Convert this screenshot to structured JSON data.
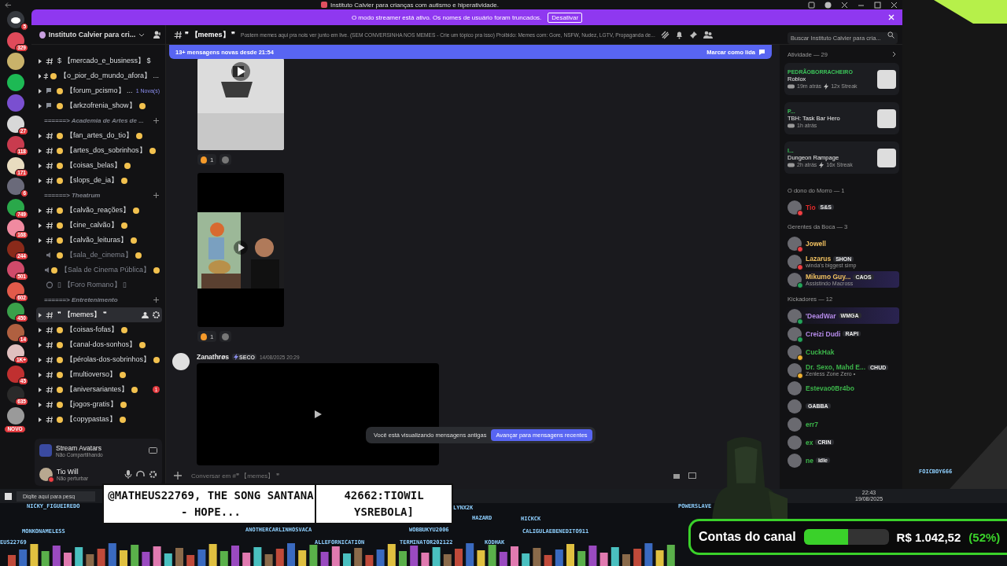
{
  "title_bar": {
    "title": "Instituto Calvier para crianças com autismo e hiperatividade."
  },
  "streamer_banner": {
    "text": "O modo streamer está ativo. Os nomes de usuário foram truncados.",
    "button": "Desativar"
  },
  "servers": [
    {
      "kind": "home",
      "badge": "5",
      "color": "#36393f"
    },
    {
      "kind": "server",
      "badge": "329",
      "color": "#e04a5a"
    },
    {
      "kind": "server",
      "color": "#c9b26a"
    },
    {
      "kind": "server",
      "color": "#1db954"
    },
    {
      "kind": "server",
      "color": "#7a4fd0"
    },
    {
      "kind": "server",
      "badge": "27",
      "color": "#d8d8d8"
    },
    {
      "kind": "server",
      "badge": "118",
      "color": "#c93b4e"
    },
    {
      "kind": "server",
      "badge": "171",
      "color": "#e8dcc0"
    },
    {
      "kind": "server",
      "badge": "6",
      "color": "#6a6a7a"
    },
    {
      "kind": "server",
      "badge": "749",
      "color": "#2aa84a"
    },
    {
      "kind": "server",
      "badge": "168",
      "color": "#f08aa0"
    },
    {
      "kind": "server",
      "badge": "244",
      "color": "#8a2a1a"
    },
    {
      "kind": "server",
      "badge": "501",
      "color": "#d04a6a"
    },
    {
      "kind": "server",
      "badge": "602",
      "color": "#e25a4a"
    },
    {
      "kind": "server",
      "badge": "450",
      "color": "#3aa04a"
    },
    {
      "kind": "server",
      "badge": "14",
      "color": "#b06040"
    },
    {
      "kind": "server",
      "badge": "1K+",
      "color": "#e0c0c0"
    },
    {
      "kind": "server",
      "badge": "45",
      "color": "#c03030"
    },
    {
      "kind": "server",
      "badge": "635",
      "color": "#2a2a2a"
    },
    {
      "kind": "server",
      "badge": "NOVO",
      "color": "#9a9a9a"
    }
  ],
  "server_header": {
    "name": "Instituto Calvier para cri..."
  },
  "channels": [
    {
      "kind": "text",
      "name": "$ 【mercado_e_business】 $",
      "selected": false
    },
    {
      "kind": "text",
      "name": "【o_pior_do_mundo_afora】 ...",
      "leading_emoji": true,
      "trailing_emoji": false,
      "selected": false
    },
    {
      "kind": "forum",
      "name": "【forum_pcismo】 ...",
      "leading_emoji": true,
      "trailing_emoji": false,
      "badge": "1 Nova(s)",
      "selected": false
    },
    {
      "kind": "forum",
      "name": "【arkzofrenia_show】",
      "leading_emoji": true,
      "trailing_emoji": true,
      "selected": false
    },
    {
      "kind": "category",
      "name": "======> Academia de Artes de ..."
    },
    {
      "kind": "text",
      "name": "【fan_artes_do_tio】",
      "leading_emoji": true,
      "trailing_emoji": true,
      "selected": false
    },
    {
      "kind": "text",
      "name": "【artes_dos_sobrinhos】",
      "leading_emoji": true,
      "trailing_emoji": true,
      "selected": false
    },
    {
      "kind": "text",
      "name": "【coisas_belas】",
      "leading_emoji": true,
      "trailing_emoji": true,
      "selected": false
    },
    {
      "kind": "text",
      "name": "【slops_de_ia】",
      "leading_emoji": true,
      "trailing_emoji": true,
      "selected": false
    },
    {
      "kind": "category",
      "name": "======> Theatrum"
    },
    {
      "kind": "text",
      "name": "【calvão_reações】",
      "leading_emoji": true,
      "trailing_emoji": true,
      "selected": false
    },
    {
      "kind": "text",
      "name": "【cine_calvão】",
      "leading_emoji": true,
      "trailing_emoji": true,
      "selected": false
    },
    {
      "kind": "text",
      "name": "【calvão_leituras】",
      "leading_emoji": true,
      "trailing_emoji": true,
      "selected": false
    },
    {
      "kind": "voice",
      "name": "【sala_de_cinema】",
      "leading_emoji": true,
      "trailing_emoji": true,
      "selected": false
    },
    {
      "kind": "voice",
      "name": "【Sala de Cinema Pública】",
      "leading_emoji": true,
      "trailing_emoji": true,
      "selected": false
    },
    {
      "kind": "stage",
      "name": "▯ 【Foro Romano】 ▯",
      "selected": false
    },
    {
      "kind": "category",
      "name": "======> Entretenimento"
    },
    {
      "kind": "text",
      "name": "❞ 【memes】 ❞",
      "selected": true
    },
    {
      "kind": "text",
      "name": "【coisas-fofas】",
      "leading_emoji": true,
      "trailing_emoji": true,
      "selected": false
    },
    {
      "kind": "text",
      "name": "【canal-dos-sonhos】",
      "leading_emoji": true,
      "trailing_emoji": true,
      "selected": false
    },
    {
      "kind": "text",
      "name": "【pérolas-dos-sobrinhos】",
      "leading_emoji": true,
      "trailing_emoji": true,
      "selected": false
    },
    {
      "kind": "text",
      "name": "【multioverso】",
      "leading_emoji": true,
      "trailing_emoji": true,
      "selected": false
    },
    {
      "kind": "text",
      "name": "【aniversariantes】",
      "leading_emoji": true,
      "trailing_emoji": true,
      "mentions": "1",
      "selected": false
    },
    {
      "kind": "text",
      "name": "【jogos-gratis】",
      "leading_emoji": true,
      "trailing_emoji": true,
      "selected": false
    },
    {
      "kind": "text",
      "name": "【copypastas】",
      "leading_emoji": true,
      "trailing_emoji": true,
      "selected": false
    }
  ],
  "app_panel": {
    "name": "Stream Avatars",
    "status": "Não Compartilhando"
  },
  "user_panel": {
    "name": "Tio Will",
    "status": "Não perturbar"
  },
  "chat_header": {
    "channel": "❞ 【memes】 ❞",
    "topic": "Postem memes aqui pra nois ver junto em live. (SEM CONVERSINHA NOS MEMES - Crie um tópico pra isso) Proibido: Memes com: Gore, NSFW, Nudez, LGTV, Propaganda de...",
    "search_placeholder": "Buscar Instituto Calvier para cria..."
  },
  "new_messages_bar": {
    "text": "13+ mensagens novas desde 21:54",
    "action": "Marcar como lida"
  },
  "messages": [
    {
      "kind": "attachment",
      "reaction_count": "1"
    },
    {
      "kind": "attachment",
      "reaction_count": "1"
    },
    {
      "kind": "message",
      "author": "Zanathrøs",
      "tag": "SECO",
      "time": "14/08/2025 20:29"
    }
  ],
  "old_messages_toast": {
    "text": "Você está visualizando mensagens antigas",
    "button": "Avançar para mensagens recentes"
  },
  "composer": {
    "placeholder": "Conversar em #❞ 【memes】 ❞"
  },
  "activity": {
    "title": "Atividade — 29",
    "items": [
      {
        "user": "PEDRÃOBORRACHEIRO",
        "game": "Roblox",
        "time": "19m atrás",
        "streak": "12x Streak"
      },
      {
        "user": "P...",
        "game": "TBH: Task Bar Hero",
        "time": "1h atrás"
      },
      {
        "user": "I...",
        "game": "Dungeon Rampage",
        "time": "2h atrás",
        "streak": "16x Streak"
      }
    ]
  },
  "member_groups": [
    {
      "title": "O dono do Morro — 1",
      "members": [
        {
          "name": "Tio",
          "color": "#e02a2a",
          "tag": "S&S",
          "status_dot": {
            "color": "#f23f43"
          },
          "highlighted": false
        }
      ]
    },
    {
      "title": "Gerentes da Boca — 3",
      "members": [
        {
          "name": "Jowell",
          "color": "#f0c060",
          "status_dot": {
            "color": "#f23f43"
          },
          "highlighted": false
        },
        {
          "name": "Lazarus",
          "color": "#f0c060",
          "tag": "SHON",
          "subtitle": "winda's biggest simp",
          "status_dot": {
            "color": "#f23f43"
          },
          "highlighted": false
        },
        {
          "name": "Mikumo Guy...",
          "color": "#f0c060",
          "tag": "CAOS",
          "subtitle": "Assistindo Macross",
          "status_dot": {
            "color": "#23a55a"
          },
          "highlighted": true
        }
      ]
    },
    {
      "title": "Kickadores — 12",
      "members": [
        {
          "name": "'DeadWar",
          "color": "#b48ae8",
          "tag": "WMGA",
          "status_dot": {
            "color": "#23a55a"
          },
          "highlighted": true
        },
        {
          "name": "Creizi Dudi",
          "color": "#b48ae8",
          "tag": "RAPI",
          "status_dot": {
            "color": "#23a55a"
          },
          "highlighted": false
        },
        {
          "name": "CuckHak",
          "color": "#3cb44a",
          "status_dot": {
            "color": "#f0b232"
          },
          "highlighted": false
        },
        {
          "name": "Dr. Sexo, Mahd E...",
          "color": "#3cb44a",
          "tag": "CHUD",
          "subtitle": "Zenless Zone Zero •",
          "status_dot": {
            "color": "#f0b232"
          },
          "highlighted": false
        },
        {
          "name": "Estevao0Br4bo",
          "color": "#3cb44a",
          "highlighted": false
        },
        {
          "tag": "GABBA",
          "highlighted": false
        },
        {
          "name": "err7",
          "color": "#3cb44a",
          "highlighted": false
        },
        {
          "name": "ex",
          "color": "#3cb44a",
          "tag": "CRIN",
          "highlighted": false
        },
        {
          "name": "ne",
          "color": "#3cb44a",
          "tag": "idle",
          "highlighted": false
        }
      ]
    }
  ],
  "taskbar": {
    "search_placeholder": "Digite aqui para pesq",
    "time": "22:43",
    "date": "19/08/2025"
  },
  "chat_bubbles": [
    {
      "text": "@MATHEUS22769, THE SONG SANTANA - HOPE..."
    },
    {
      "text": "42662:TIOWIL YSREBOLA]"
    }
  ],
  "overlay_names": [
    "NICKY_FIGUEIREDO",
    "MONKONAMELESS",
    "EUS22769",
    "ANOTHERCARLINHOSVACA",
    "ALLEFORNICATION",
    "WOBBUKYU2006",
    "TERMINATOR202122",
    "HAZARD",
    "KODHAK",
    "LYNX2K",
    "HICKCK",
    "CALIGULAEBENEDITO911",
    "POWERSLAVE",
    "FOICBOY666"
  ],
  "channel_goal": {
    "label": "Contas do canal",
    "level": 0.52,
    "amount": "R$ 1.042,52",
    "percent": "(52%)"
  }
}
